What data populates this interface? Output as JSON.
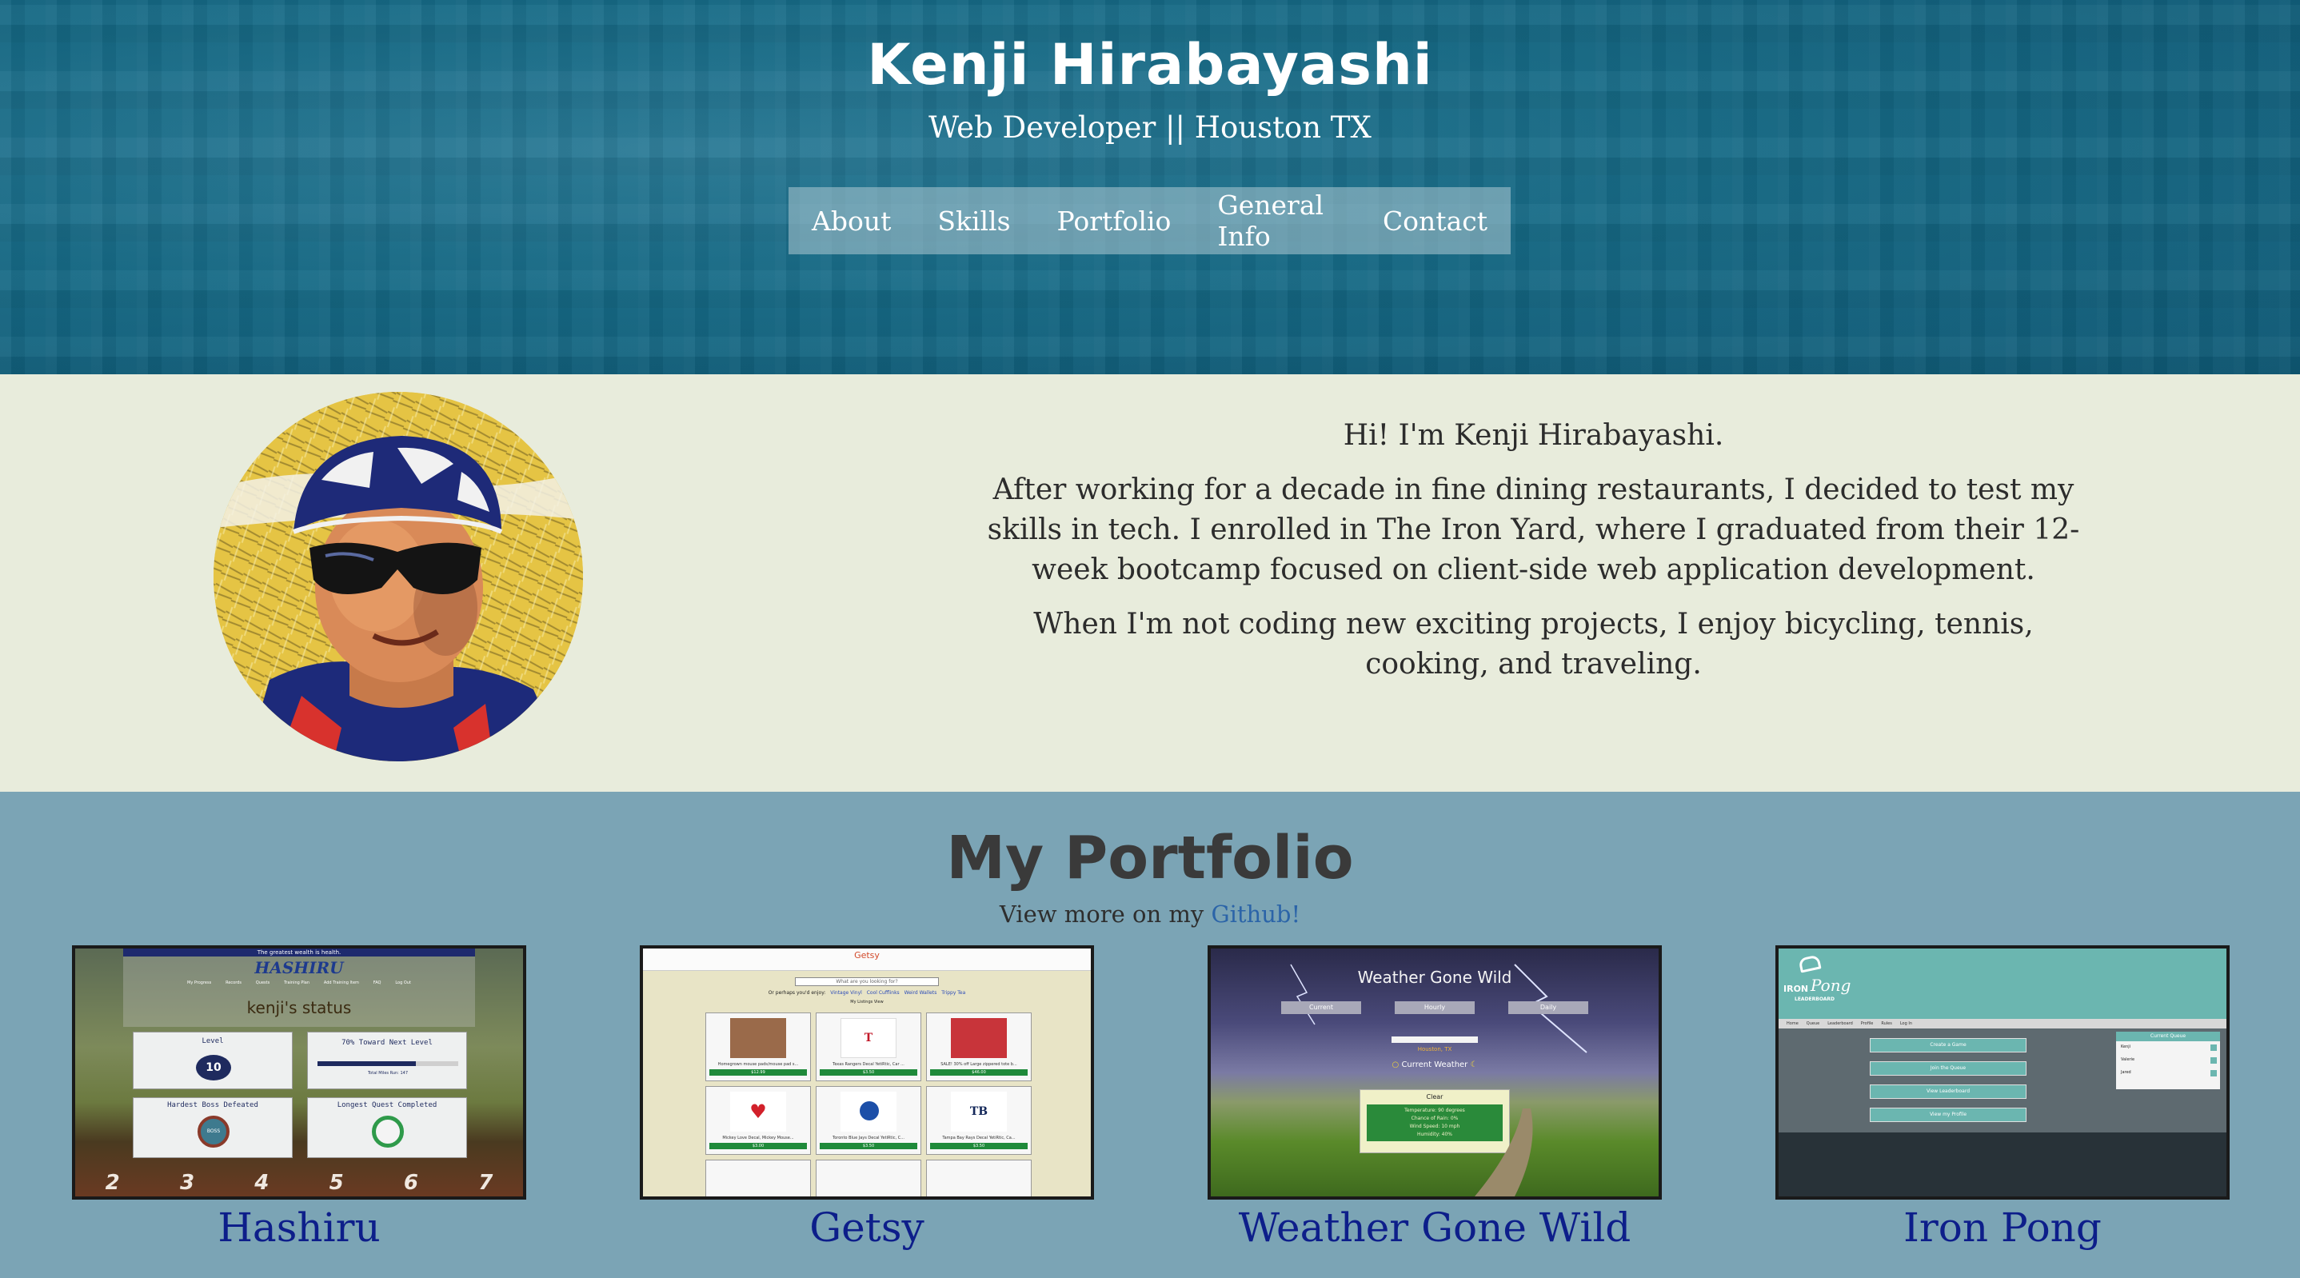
{
  "header": {
    "title": "Kenji Hirabayashi",
    "subtitle": "Web Developer || Houston TX",
    "nav": [
      {
        "label": "About"
      },
      {
        "label": "Skills"
      },
      {
        "label": "Portfolio"
      },
      {
        "label": "General Info"
      },
      {
        "label": "Contact"
      }
    ]
  },
  "about": {
    "greeting": "Hi! I'm Kenji Hirabayashi.",
    "bio": "After working for a decade in fine dining restaurants, I decided to test my skills in tech. I enrolled in The Iron Yard, where I graduated from their 12-week bootcamp focused on client-side web application development.",
    "hobbies": "When I'm not coding new exciting projects, I enjoy bicycling, tennis, cooking, and traveling."
  },
  "portfolio": {
    "title": "My Portfolio",
    "subtitle_prefix": "View more on my ",
    "github_label": "Github!",
    "projects": [
      {
        "name": "Hashiru",
        "thumb": {
          "tagline": "The greatest wealth is health.",
          "logo": "HASHIRU",
          "nav": [
            "My Progress",
            "Records",
            "Quests",
            "Training Plan",
            "Add Training Item",
            "FAQ",
            "Log Out"
          ],
          "status": "kenji's status",
          "tiles": [
            "Level",
            "70% Toward Next Level",
            "Hardest Boss Defeated",
            "Longest Quest Completed"
          ],
          "level": "10",
          "progress_note": "Total Miles Run: 147",
          "progress": 0.7,
          "badge": "BOSS",
          "lanes": [
            "2",
            "3",
            "4",
            "5",
            "6",
            "7"
          ]
        }
      },
      {
        "name": "Getsy",
        "thumb": {
          "logo": "Getsy",
          "search_placeholder": "What are you looking for?",
          "prompt": "Or perhaps you'd enjoy:",
          "links": [
            "Vintage Vinyl",
            "Cool Cufflinks",
            "Weird Wallets",
            "Trippy Tea"
          ],
          "listings_label": "My Listings View",
          "items": [
            {
              "caption": "Homegrown mouse pads/mouse pad s...",
              "price": "$12.99"
            },
            {
              "caption": "Texas Rangers Decal YetiRtic, Car ...",
              "price": "$3.50"
            },
            {
              "caption": "SALE! 30% off Large zippered tote b...",
              "price": "$46.00"
            },
            {
              "caption": "Mickey Love Decal, Mickey Mouse...",
              "price": "$3.00"
            },
            {
              "caption": "Toronto Blue Jays Decal YetiRtic, C...",
              "price": "$3.50"
            },
            {
              "caption": "Tampa Bay Rays Decal YetiRtic, Ca...",
              "price": "$3.50"
            }
          ]
        }
      },
      {
        "name": "Weather Gone Wild",
        "thumb": {
          "heading": "Weather Gone Wild",
          "tabs": [
            "Current",
            "Hourly",
            "Daily"
          ],
          "location": "Houston, TX",
          "current_label": "Current Weather",
          "condition": "Clear",
          "details": [
            "Temperature: 90 degrees",
            "Chance of Rain: 0%",
            "Wind Speed: 10 mph",
            "Humidity: 40%"
          ]
        }
      },
      {
        "name": "Iron Pong",
        "thumb": {
          "logo_top": "IRON",
          "logo_script": "Pong",
          "logo_sub": "LEADERBOARD",
          "nav": [
            "Home",
            "Queue",
            "Leaderboard",
            "Profile",
            "Rules",
            "Log In"
          ],
          "buttons": [
            "Create a Game",
            "Join the Queue",
            "View Leaderboard",
            "View my Profile"
          ],
          "queue_title": "Current Queue",
          "queue": [
            "Kenji",
            "Valerie",
            "Jared"
          ]
        }
      }
    ]
  }
}
